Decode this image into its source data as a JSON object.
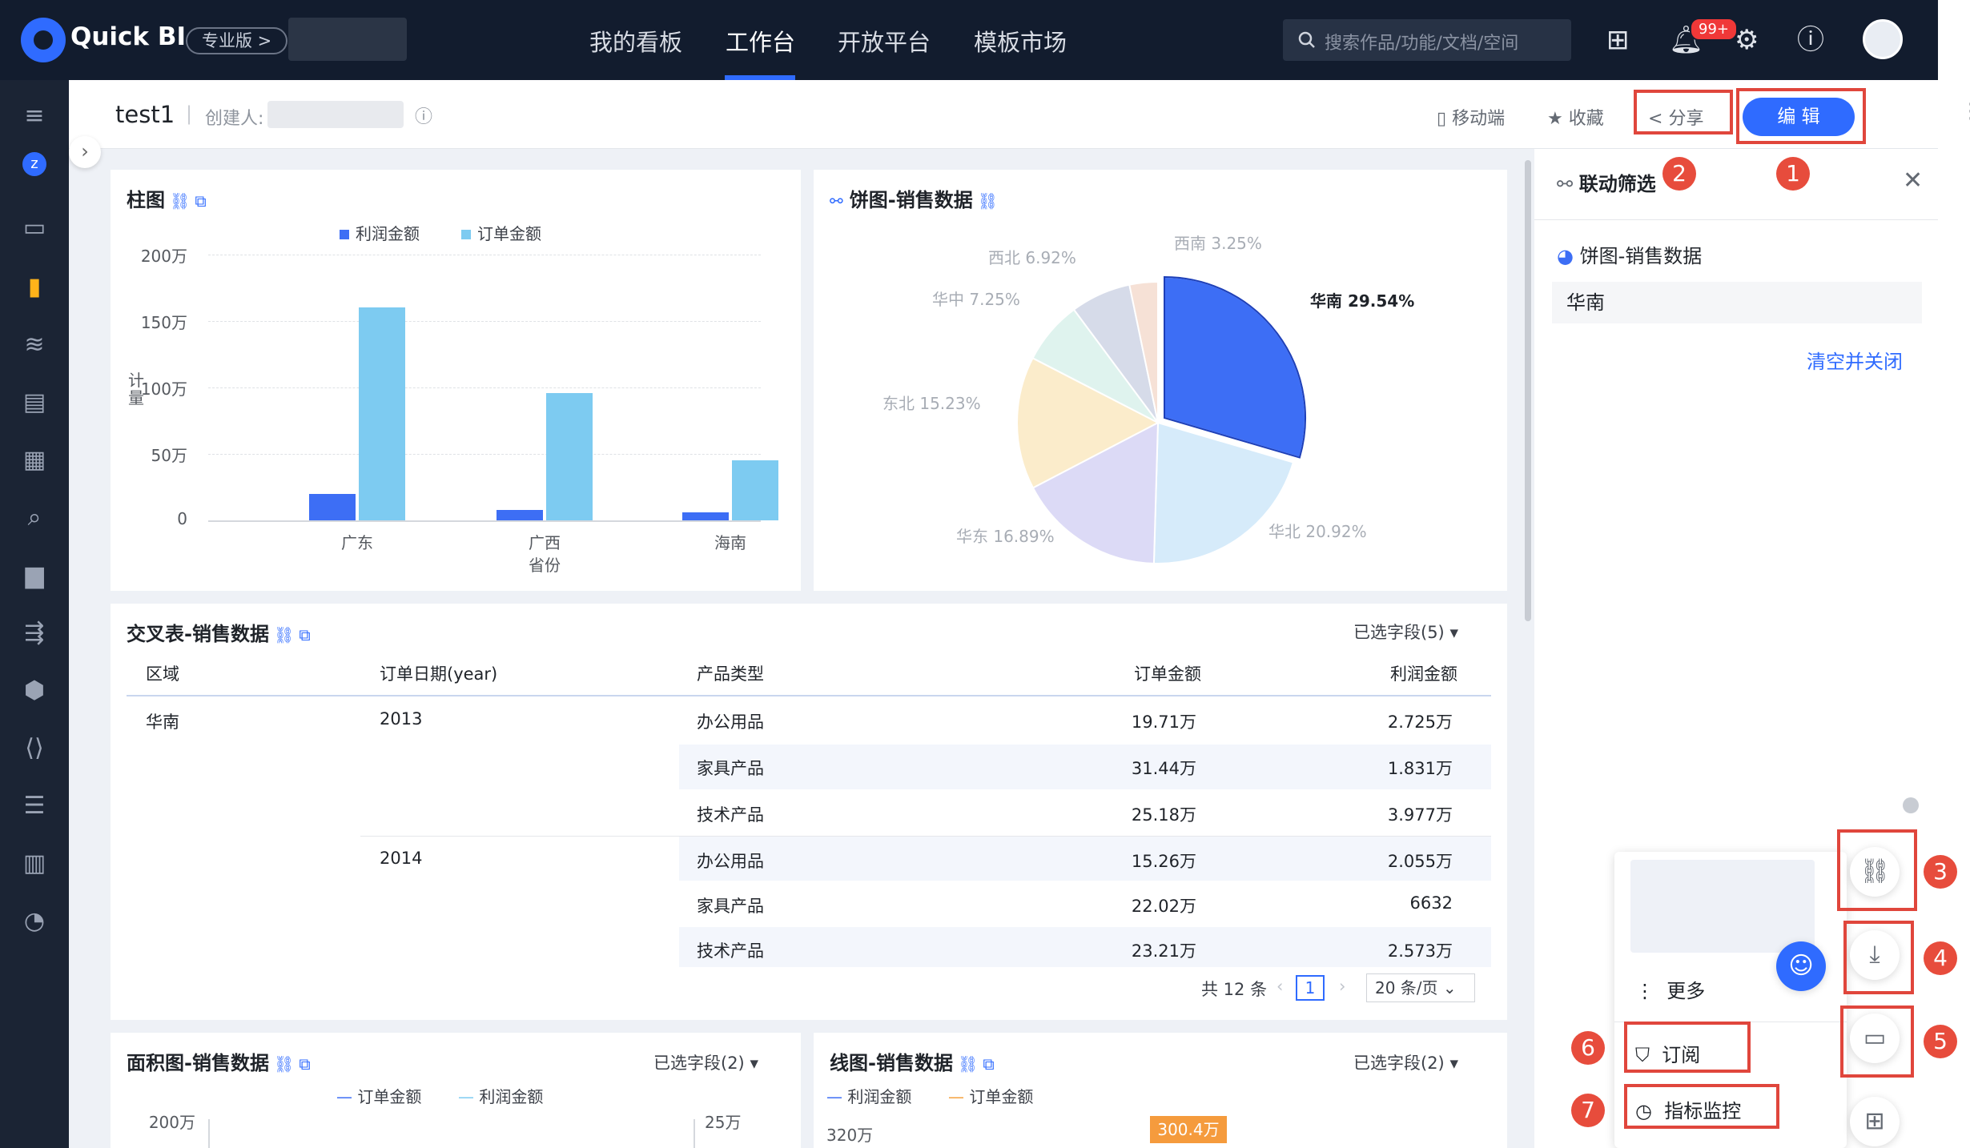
{
  "topbar": {
    "brand": "Quick BI",
    "edition": "专业版 >",
    "nav": [
      "我的看板",
      "工作台",
      "开放平台",
      "模板市场"
    ],
    "active_nav": "工作台",
    "search_placeholder": "搜索作品/功能/文档/空间",
    "notify_badge": "99+"
  },
  "subbar": {
    "title": "test1",
    "creator_label": "创建人:",
    "mobile": "移动端",
    "favorite": "收藏",
    "share": "分享",
    "edit": "编 辑"
  },
  "bar_chart": {
    "title": "柱图",
    "chart_data": {
      "type": "bar",
      "categories": [
        "广东",
        "广西",
        "海南"
      ],
      "series": [
        {
          "name": "利润金额",
          "values": [
            200000,
            80000,
            60000
          ],
          "color": "#3d6ef5"
        },
        {
          "name": "订单金额",
          "values": [
            1600000,
            960000,
            450000
          ],
          "color": "#7dcbf1"
        }
      ],
      "xlabel": "省份",
      "ylabel": "计量",
      "yticks": [
        "200万",
        "150万",
        "100万",
        "50万",
        "0"
      ],
      "ylim": [
        0,
        2000000
      ]
    }
  },
  "pie_chart": {
    "title": "饼图-销售数据",
    "chart_data": {
      "type": "pie",
      "labels": [
        "华南",
        "华北",
        "华东",
        "东北",
        "华中",
        "西北",
        "西南"
      ],
      "values": [
        29.54,
        20.92,
        16.89,
        15.23,
        7.25,
        6.92,
        3.25
      ],
      "display": [
        "华南 29.54%",
        "华北 20.92%",
        "华东 16.89%",
        "东北 15.23%",
        "华中 7.25%",
        "西北 6.92%",
        "西南 3.25%"
      ],
      "colors": [
        "#3d6ef5",
        "#d6ebfa",
        "#dcdaf6",
        "#fbeccb",
        "#dff3ee",
        "#d6dbe9",
        "#f6e1d6"
      ]
    }
  },
  "cross_table": {
    "title": "交叉表-销售数据",
    "selected_fields": "已选字段(5)",
    "headers": [
      "区域",
      "订单日期(year)",
      "产品类型",
      "订单金额",
      "利润金额"
    ],
    "region": "华南",
    "years": [
      "2013",
      "2014"
    ],
    "rows": [
      [
        "办公用品",
        "19.71万",
        "2.725万"
      ],
      [
        "家具产品",
        "31.44万",
        "1.831万"
      ],
      [
        "技术产品",
        "25.18万",
        "3.977万"
      ],
      [
        "办公用品",
        "15.26万",
        "2.055万"
      ],
      [
        "家具产品",
        "22.02万",
        "6632"
      ],
      [
        "技术产品",
        "23.21万",
        "2.573万"
      ]
    ],
    "total": "共 12 条",
    "page": "1",
    "page_size": "20 条/页"
  },
  "area_chart": {
    "title": "面积图-销售数据",
    "selected_fields": "已选字段(2)",
    "legend": [
      "订单金额",
      "利润金额"
    ],
    "ytick_left": "200万",
    "ytick_right": "25万"
  },
  "line_chart": {
    "title": "线图-销售数据",
    "selected_fields": "已选字段(2)",
    "legend": [
      "利润金额",
      "订单金额"
    ],
    "ytick": "320万",
    "tooltip": "300.4万"
  },
  "right_panel": {
    "title": "联动筛选",
    "source": "饼图-销售数据",
    "value": "华南",
    "clear": "清空并关闭"
  },
  "float_menu": {
    "more": "更多",
    "subscribe": "订阅",
    "monitor": "指标监控"
  },
  "markers": [
    "1",
    "2",
    "3",
    "4",
    "5",
    "6",
    "7"
  ]
}
